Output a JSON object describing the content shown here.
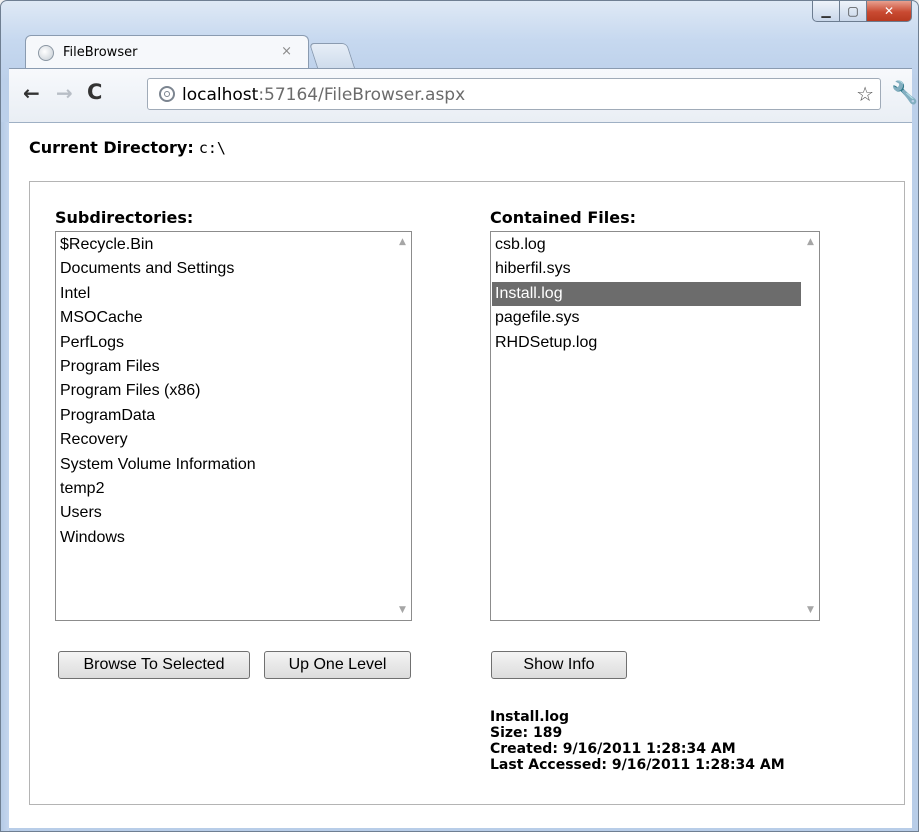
{
  "browser": {
    "tab_title": "FileBrowser",
    "tab_close": "×",
    "url_host": "localhost",
    "url_rest": ":57164/FileBrowser.aspx",
    "window_controls": {
      "minimize": "▁",
      "maximize": "▢",
      "close": "✕"
    },
    "icons": {
      "back": "←",
      "forward": "→",
      "reload": "C",
      "star": "☆",
      "wrench": "🔧"
    }
  },
  "page": {
    "current_directory_label": "Current Directory:",
    "current_directory_value": "c:\\",
    "subdirectories": {
      "label": "Subdirectories:",
      "items": [
        "$Recycle.Bin",
        "Documents and Settings",
        "Intel",
        "MSOCache",
        "PerfLogs",
        "Program Files",
        "Program Files (x86)",
        "ProgramData",
        "Recovery",
        "System Volume Information",
        "temp2",
        "Users",
        "Windows"
      ]
    },
    "files": {
      "label": "Contained Files:",
      "items": [
        "csb.log",
        "hiberfil.sys",
        "Install.log",
        "pagefile.sys",
        "RHDSetup.log"
      ],
      "selected_index": 2
    },
    "buttons": {
      "browse": "Browse To Selected",
      "up": "Up One Level",
      "show_info": "Show Info"
    },
    "file_info": {
      "name": "Install.log",
      "size": "Size: 189",
      "created": "Created: 9/16/2011 1:28:34 AM",
      "accessed": "Last Accessed: 9/16/2011 1:28:34 AM"
    },
    "scroll_arrows": {
      "up": "▲",
      "down": "▼"
    }
  }
}
